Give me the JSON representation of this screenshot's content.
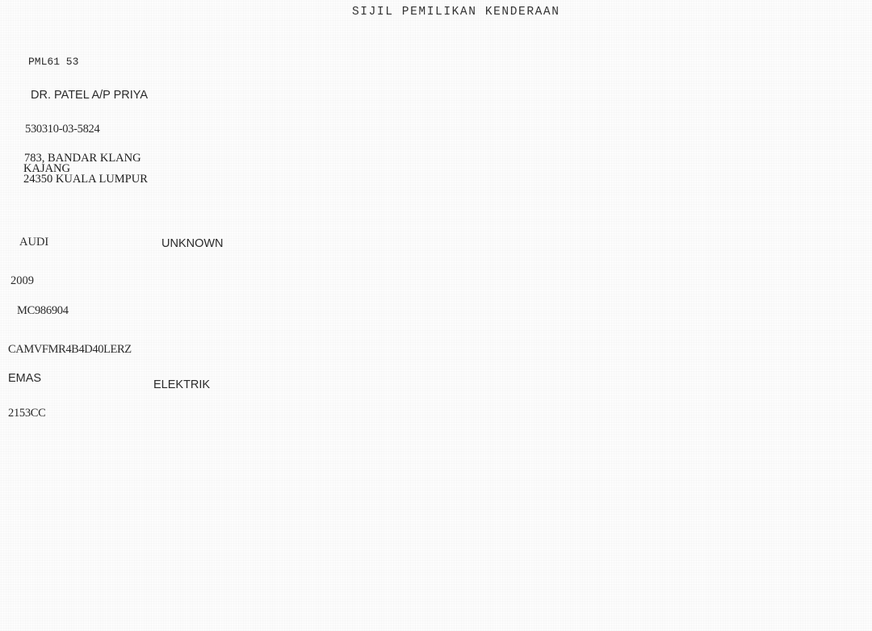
{
  "document": {
    "title": "SIJIL PEMILIKAN KENDERAAN"
  },
  "registration": {
    "plate_number": "PML61 53"
  },
  "owner": {
    "name": "DR. PATEL A/P PRIYA",
    "ic_number": "530310-03-5824",
    "address_line1": "783, BANDAR KLANG",
    "address_line2": "KAJANG",
    "address_line3": "24350 KUALA LUMPUR"
  },
  "vehicle": {
    "make": "AUDI",
    "model": "UNKNOWN",
    "year": "2009",
    "engine_number": "MC986904",
    "chassis_number": "CAMVFMR4B4D40LERZ",
    "colour": "EMAS",
    "fuel": "ELEKTRIK",
    "capacity": "2153CC"
  }
}
